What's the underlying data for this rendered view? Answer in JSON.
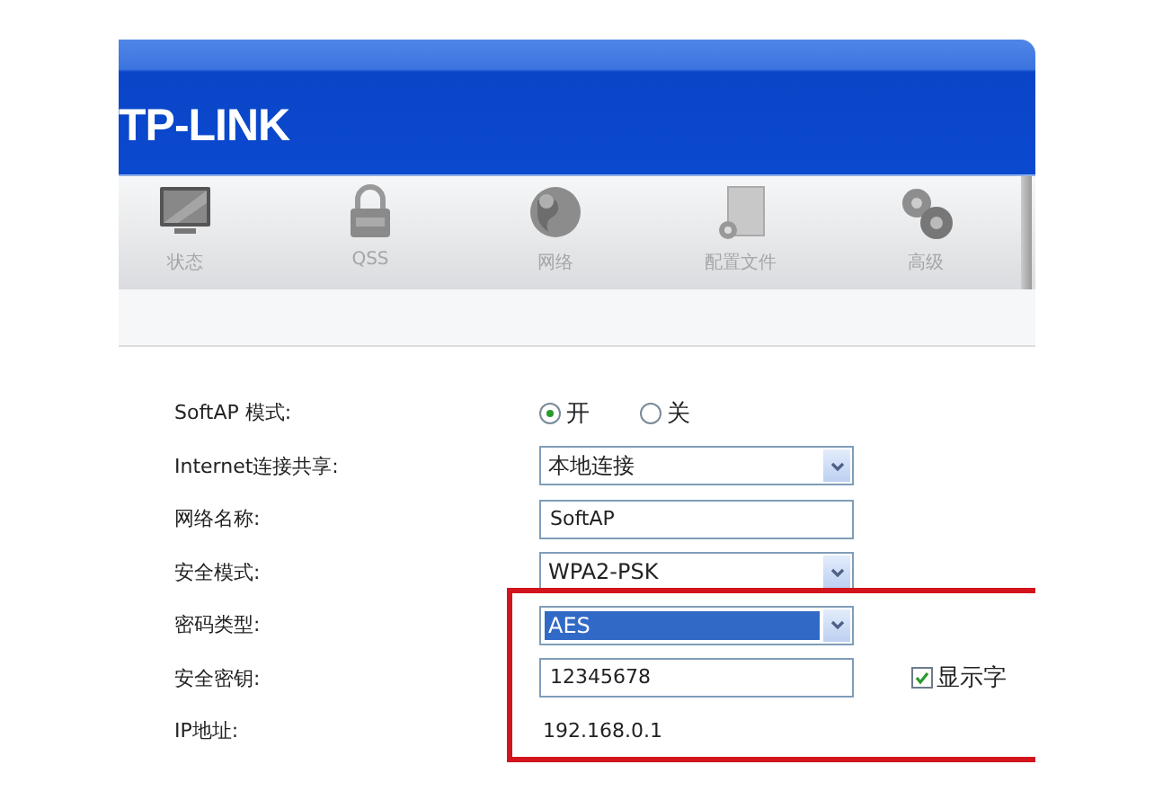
{
  "header": {
    "logo": "TP-LINK"
  },
  "toolbar": [
    {
      "label": "状态"
    },
    {
      "label": "QSS"
    },
    {
      "label": "网络"
    },
    {
      "label": "配置文件"
    },
    {
      "label": "高级"
    }
  ],
  "form": [
    {
      "label": "SoftAP 模式:",
      "kind": "radio",
      "options": [
        {
          "label": "开",
          "selected": true
        },
        {
          "label": "关",
          "selected": false
        }
      ]
    },
    {
      "label": "Internet连接共享:",
      "kind": "select",
      "value": "本地连接",
      "highlighted": false
    },
    {
      "label": "网络名称:",
      "kind": "text",
      "value": "SoftAP"
    },
    {
      "label": "安全模式:",
      "kind": "select",
      "value": "WPA2-PSK",
      "highlighted": false
    },
    {
      "label": "密码类型:",
      "kind": "select",
      "value": "AES",
      "highlighted": true
    },
    {
      "label": "安全密钥:",
      "kind": "text",
      "value": "12345678",
      "checkbox": {
        "label": "显示字",
        "checked": true
      }
    },
    {
      "label": "IP地址:",
      "kind": "static",
      "value": "192.168.0.1"
    }
  ]
}
